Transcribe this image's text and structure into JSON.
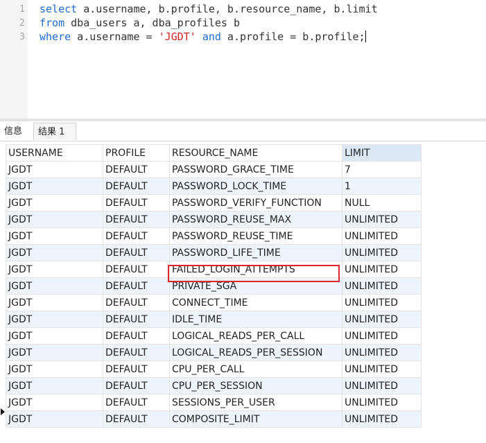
{
  "editor": {
    "lines": [
      {
        "num": "1",
        "tokens": [
          {
            "t": "select",
            "k": "kw"
          },
          {
            "t": " a.username, b.profile, b.resource_name, b.limit",
            "k": ""
          }
        ]
      },
      {
        "num": "2",
        "tokens": [
          {
            "t": "from",
            "k": "kw"
          },
          {
            "t": " dba_users a, dba_profiles b",
            "k": ""
          }
        ]
      },
      {
        "num": "3",
        "tokens": [
          {
            "t": "where",
            "k": "kw"
          },
          {
            "t": " a.username = ",
            "k": ""
          },
          {
            "t": "'JGDT'",
            "k": "str"
          },
          {
            "t": " ",
            "k": ""
          },
          {
            "t": "and",
            "k": "kw"
          },
          {
            "t": " a.profile = b.profile;",
            "k": ""
          }
        ]
      }
    ]
  },
  "tabs": {
    "info_label": "信息",
    "result_label": "结果 1"
  },
  "grid": {
    "columns": [
      "USERNAME",
      "PROFILE",
      "RESOURCE_NAME",
      "LIMIT"
    ],
    "rows": [
      [
        "JGDT",
        "DEFAULT",
        "PASSWORD_GRACE_TIME",
        "7"
      ],
      [
        "JGDT",
        "DEFAULT",
        "PASSWORD_LOCK_TIME",
        "1"
      ],
      [
        "JGDT",
        "DEFAULT",
        "PASSWORD_VERIFY_FUNCTION",
        "NULL"
      ],
      [
        "JGDT",
        "DEFAULT",
        "PASSWORD_REUSE_MAX",
        "UNLIMITED"
      ],
      [
        "JGDT",
        "DEFAULT",
        "PASSWORD_REUSE_TIME",
        "UNLIMITED"
      ],
      [
        "JGDT",
        "DEFAULT",
        "PASSWORD_LIFE_TIME",
        "UNLIMITED"
      ],
      [
        "JGDT",
        "DEFAULT",
        "FAILED_LOGIN_ATTEMPTS",
        "UNLIMITED"
      ],
      [
        "JGDT",
        "DEFAULT",
        "PRIVATE_SGA",
        "UNLIMITED"
      ],
      [
        "JGDT",
        "DEFAULT",
        "CONNECT_TIME",
        "UNLIMITED"
      ],
      [
        "JGDT",
        "DEFAULT",
        "IDLE_TIME",
        "UNLIMITED"
      ],
      [
        "JGDT",
        "DEFAULT",
        "LOGICAL_READS_PER_CALL",
        "UNLIMITED"
      ],
      [
        "JGDT",
        "DEFAULT",
        "LOGICAL_READS_PER_SESSION",
        "UNLIMITED"
      ],
      [
        "JGDT",
        "DEFAULT",
        "CPU_PER_CALL",
        "UNLIMITED"
      ],
      [
        "JGDT",
        "DEFAULT",
        "CPU_PER_SESSION",
        "UNLIMITED"
      ],
      [
        "JGDT",
        "DEFAULT",
        "SESSIONS_PER_USER",
        "UNLIMITED"
      ],
      [
        "JGDT",
        "DEFAULT",
        "COMPOSITE_LIMIT",
        "UNLIMITED"
      ]
    ],
    "current_row_index": 14,
    "highlighted_row_index": 6
  },
  "colors": {
    "keyword": "#1b6bd6",
    "string": "#d02222",
    "highlight_border": "#e0262a",
    "sorted_header": "#dce8f5",
    "alt_row": "#eef4fb"
  }
}
